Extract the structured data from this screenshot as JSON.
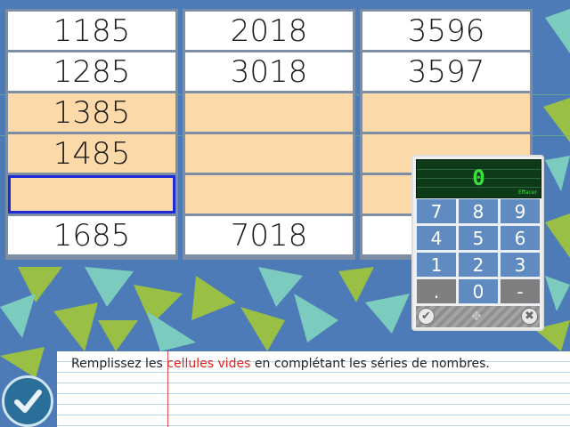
{
  "columns": [
    {
      "cells": [
        {
          "value": "1185",
          "style": "white"
        },
        {
          "value": "1285",
          "style": "white"
        },
        {
          "value": "1385",
          "style": "peach"
        },
        {
          "value": "1485",
          "style": "peach"
        },
        {
          "value": "",
          "style": "peach",
          "selected": true
        },
        {
          "value": "1685",
          "style": "white"
        }
      ]
    },
    {
      "cells": [
        {
          "value": "2018",
          "style": "white"
        },
        {
          "value": "3018",
          "style": "white"
        },
        {
          "value": "",
          "style": "peach"
        },
        {
          "value": "",
          "style": "peach"
        },
        {
          "value": "",
          "style": "peach"
        },
        {
          "value": "7018",
          "style": "white"
        }
      ]
    },
    {
      "cells": [
        {
          "value": "3596",
          "style": "white"
        },
        {
          "value": "3597",
          "style": "white"
        },
        {
          "value": "",
          "style": "peach"
        },
        {
          "value": "",
          "style": "peach"
        },
        {
          "value": "",
          "style": "peach"
        },
        {
          "value": "",
          "style": "white"
        }
      ]
    }
  ],
  "keypad": {
    "display_value": "0",
    "clear_label": "Effacer",
    "keys": [
      "7",
      "8",
      "9",
      "4",
      "5",
      "6",
      "1",
      "2",
      "3",
      ".",
      "0",
      "-"
    ]
  },
  "instruction": {
    "part1": "Remplissez les ",
    "highlight": "cellules vides",
    "part2": " en complétant les séries de nombres."
  },
  "colors": {
    "highlight": "#e0221a",
    "selected_border": "#1d2bd6",
    "display_text": "#39e03c"
  }
}
